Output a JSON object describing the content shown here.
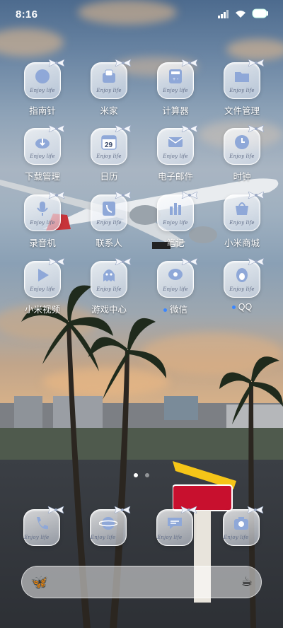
{
  "status_bar": {
    "time": "8:16",
    "battery_label": ""
  },
  "apps": [
    {
      "label": "指南针",
      "icon": "compass-icon",
      "tag": "Enjoy life"
    },
    {
      "label": "米家",
      "icon": "home-icon",
      "tag": "Enjoy life"
    },
    {
      "label": "计算器",
      "icon": "calculator-icon",
      "tag": "Enjoy life"
    },
    {
      "label": "文件管理",
      "icon": "folder-icon",
      "tag": "Enjoy life"
    },
    {
      "label": "下载管理",
      "icon": "cloud-download-icon",
      "tag": "Enjoy life"
    },
    {
      "label": "日历",
      "icon": "calendar-icon",
      "tag": "Enjoy life",
      "day": "29"
    },
    {
      "label": "电子邮件",
      "icon": "mail-icon",
      "tag": "Enjoy life"
    },
    {
      "label": "时钟",
      "icon": "clock-icon",
      "tag": "Enjoy life"
    },
    {
      "label": "录音机",
      "icon": "microphone-icon",
      "tag": "Enjoy life"
    },
    {
      "label": "联系人",
      "icon": "contacts-icon",
      "tag": "Enjoy life"
    },
    {
      "label": "笔记",
      "icon": "notes-icon",
      "tag": "Enjoy life"
    },
    {
      "label": "小米商城",
      "icon": "shopping-bag-icon",
      "tag": "Enjoy life"
    },
    {
      "label": "小米视频",
      "icon": "play-icon",
      "tag": "Enjoy life"
    },
    {
      "label": "游戏中心",
      "icon": "ghost-icon",
      "tag": "Enjoy life"
    },
    {
      "label": "微信",
      "icon": "chat-icon",
      "tag": "Enjoy life"
    },
    {
      "label": "QQ",
      "icon": "penguin-icon",
      "tag": "Enjoy life"
    }
  ],
  "dock": [
    {
      "icon": "phone-icon",
      "tag": "Enjoy life"
    },
    {
      "icon": "browser-icon",
      "tag": "Enjoy life"
    },
    {
      "icon": "messages-icon",
      "tag": "Enjoy life"
    },
    {
      "icon": "camera-icon",
      "tag": "Enjoy life"
    }
  ],
  "page_indicator": {
    "pages": 2,
    "current": 1
  },
  "search": {
    "left_icon": "butterfly-icon",
    "right_icon": "coffee-icon"
  },
  "colors": {
    "accent": "#3a86ff",
    "glyph": "#8fa8d8"
  }
}
